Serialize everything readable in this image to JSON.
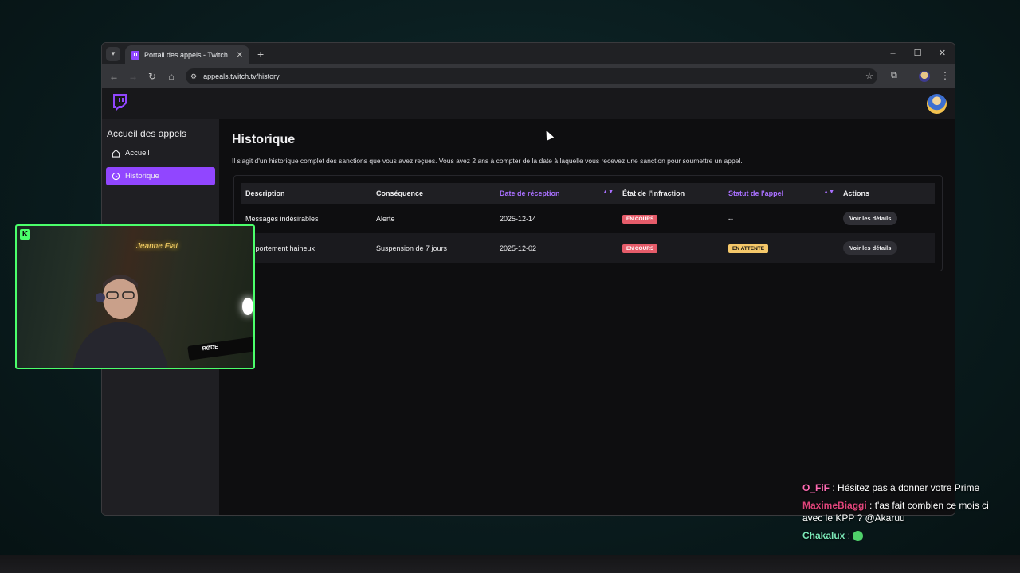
{
  "browser": {
    "tab_title": "Portail des appels - Twitch",
    "url": "appeals.twitch.tv/history"
  },
  "sidebar": {
    "title": "Accueil des appels",
    "items": [
      {
        "label": "Accueil",
        "icon": "home-icon",
        "active": false
      },
      {
        "label": "Historique",
        "icon": "history-icon",
        "active": true
      }
    ]
  },
  "main": {
    "title": "Historique",
    "description": "Il s'agit d'un historique complet des sanctions que vous avez reçues. Vous avez 2 ans à compter de la date à laquelle vous recevez une sanction pour soumettre un appel."
  },
  "table": {
    "headers": [
      "Description",
      "Conséquence",
      "Date de réception",
      "État de l'infraction",
      "Statut de l'appel",
      "Actions"
    ],
    "rows": [
      {
        "description": "Messages indésirables",
        "consequence": "Alerte",
        "date": "2025-12-14",
        "infraction_status": "EN COURS",
        "appeal_status": "--",
        "action": "Voir les détails"
      },
      {
        "description": "omportement haineux",
        "consequence": "Suspension de 7 jours",
        "date": "2025-12-02",
        "infraction_status": "EN COURS",
        "appeal_status": "EN ATTENTE",
        "action": "Voir les détails"
      }
    ]
  },
  "webcam": {
    "neon_sign": "Jeanne Fiat",
    "mic_brand": "RØDE"
  },
  "chat": [
    {
      "user": "O_FiF",
      "color": "#ff6bb3",
      "text": "Hésitez pas à donner votre Prime"
    },
    {
      "user": "MaximeBiaggi",
      "color": "#e0457b",
      "text": "t'as fait combien ce mois ci avec le KPP ? @Akaruu"
    },
    {
      "user": "Chakalux",
      "color": "#7be8b8",
      "text": ""
    }
  ],
  "colors": {
    "brand": "#9146ff",
    "badge_red": "#e65c6a",
    "badge_yellow": "#f5c86a",
    "webcam_border": "#4bff6b"
  }
}
